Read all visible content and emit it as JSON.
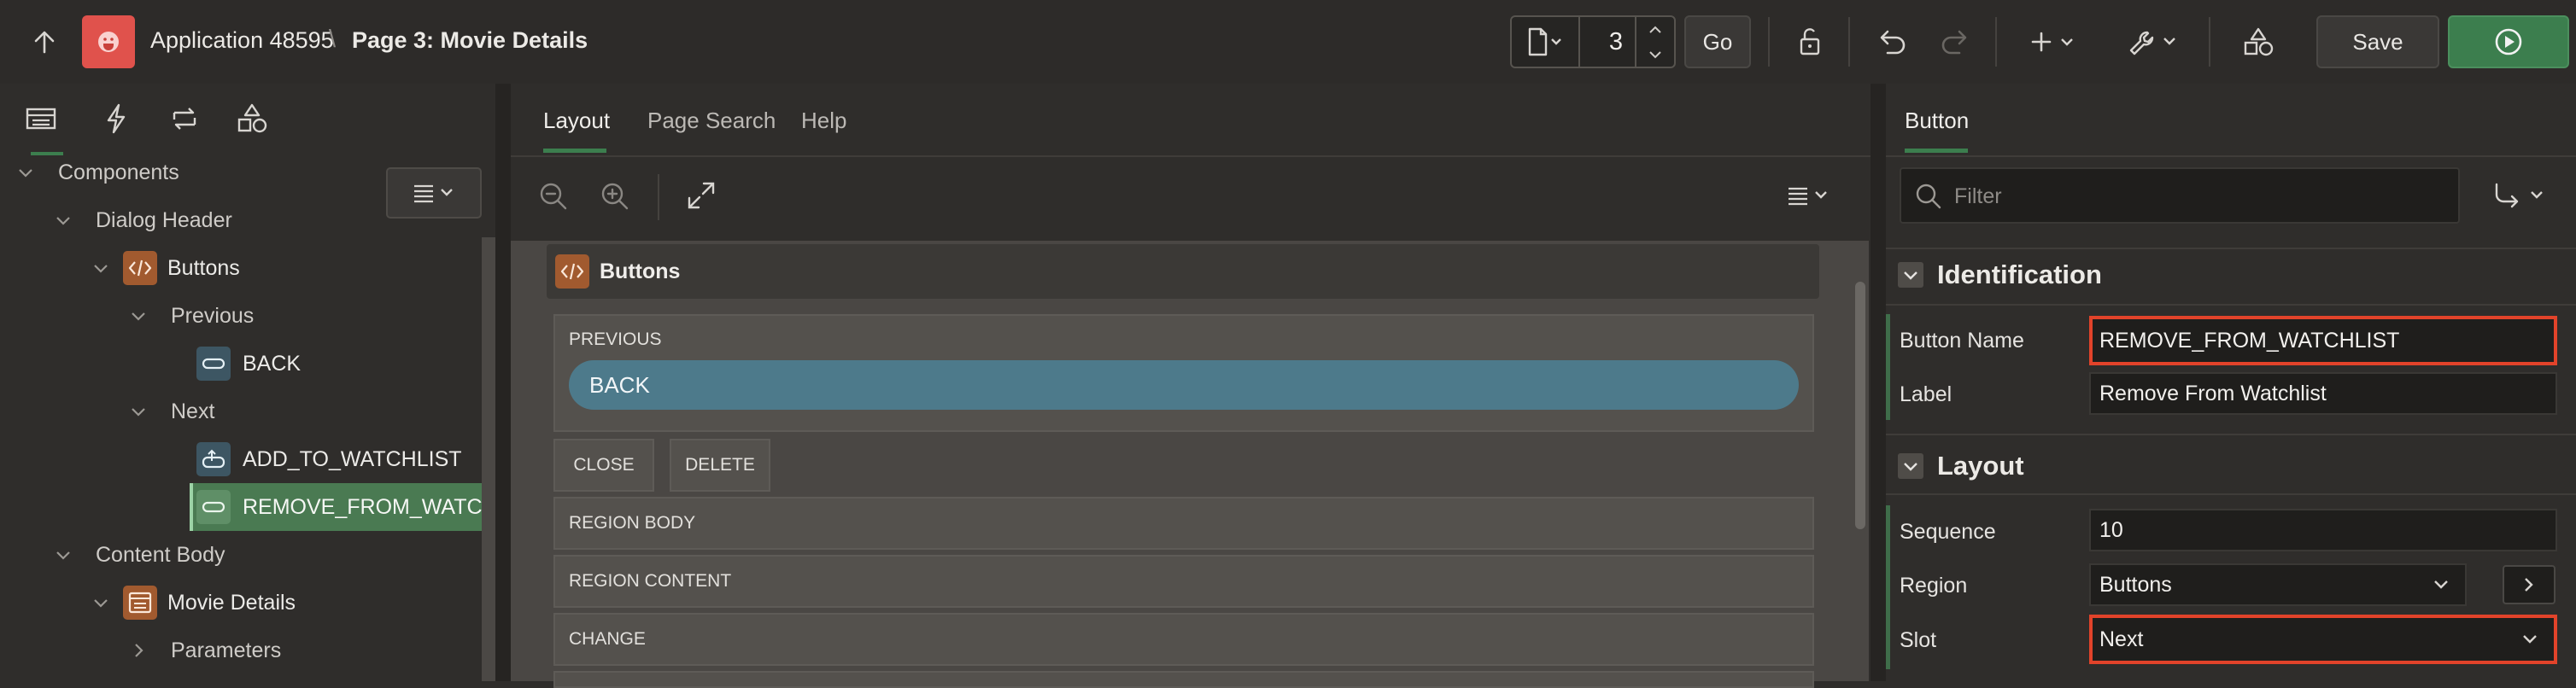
{
  "header": {
    "app_name": "Application 48595",
    "path_separator": "\\",
    "page_title": "Page 3: Movie Details",
    "page_number": "3",
    "go_label": "Go",
    "save_label": "Save"
  },
  "left_tree": {
    "tabs": [
      "rendering-icon",
      "dynamic-actions-icon",
      "processing-icon",
      "shared-components-icon"
    ],
    "items": [
      {
        "label": "Components"
      },
      {
        "label": "Dialog Header"
      },
      {
        "label": "Buttons"
      },
      {
        "label": "Previous"
      },
      {
        "label": "BACK"
      },
      {
        "label": "Next"
      },
      {
        "label": "ADD_TO_WATCHLIST"
      },
      {
        "label": "REMOVE_FROM_WATCHLIST"
      },
      {
        "label": "Content Body"
      },
      {
        "label": "Movie Details"
      },
      {
        "label": "Parameters"
      }
    ]
  },
  "center": {
    "tabs": [
      {
        "label": "Layout"
      },
      {
        "label": "Page Search"
      },
      {
        "label": "Help"
      }
    ],
    "canvas": {
      "region_title": "Buttons",
      "previous_label": "PREVIOUS",
      "back_button": "BACK",
      "close_slot": "CLOSE",
      "delete_slot": "DELETE",
      "region_body": "REGION BODY",
      "region_content": "REGION CONTENT",
      "change": "CHANGE"
    }
  },
  "property_editor": {
    "tab": "Button",
    "filter_placeholder": "Filter",
    "groups": {
      "identification": {
        "title": "Identification",
        "button_name_label": "Button Name",
        "button_name_value": "REMOVE_FROM_WATCHLIST",
        "label_label": "Label",
        "label_value": "Remove From Watchlist"
      },
      "layout": {
        "title": "Layout",
        "sequence_label": "Sequence",
        "sequence_value": "10",
        "region_label": "Region",
        "region_value": "Buttons",
        "slot_label": "Slot",
        "slot_value": "Next"
      }
    }
  },
  "colors": {
    "accent_green": "#3c7e4e",
    "app_icon_red": "#e0524c",
    "button_blue": "#4d7a8b",
    "highlight_red": "#e2432a",
    "selected_tree": "#4a7a52"
  }
}
